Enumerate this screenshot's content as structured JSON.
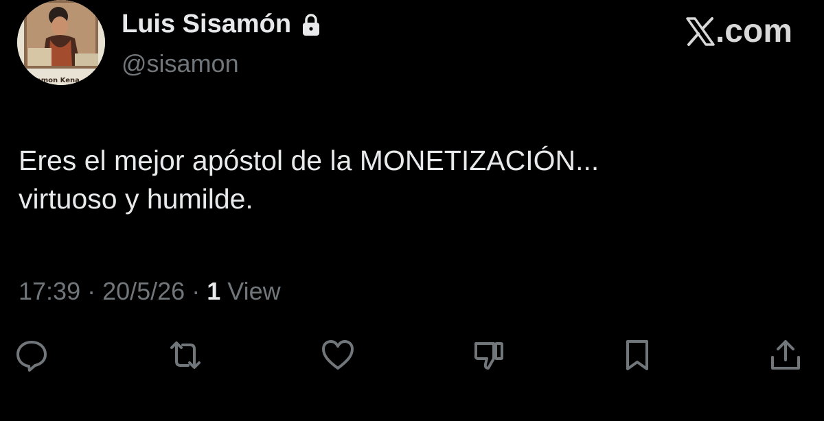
{
  "author": {
    "display_name": "Luis Sisamón",
    "handle": "@sisamon",
    "protected_icon": "lock-icon",
    "avatar_caption": "amon Kena"
  },
  "site": {
    "label": ".com",
    "logo_icon": "x-logo-icon"
  },
  "tweet": {
    "text_lines": [
      "Eres el mejor apóstol de la MONETIZACIÓN...",
      "virtuoso y humilde."
    ],
    "time": "17:39",
    "separator": " · ",
    "date": "20/5/26",
    "views_count": "1",
    "views_label": "View"
  },
  "actions": [
    {
      "name": "reply",
      "icon": "reply-icon"
    },
    {
      "name": "repost",
      "icon": "repost-icon"
    },
    {
      "name": "like",
      "icon": "heart-icon"
    },
    {
      "name": "dislike",
      "icon": "thumbs-down-icon"
    },
    {
      "name": "bookmark",
      "icon": "bookmark-icon"
    },
    {
      "name": "share",
      "icon": "share-icon"
    }
  ],
  "colors": {
    "background": "#000000",
    "primary_text": "#e7e9ea",
    "secondary_text": "#71767b"
  }
}
